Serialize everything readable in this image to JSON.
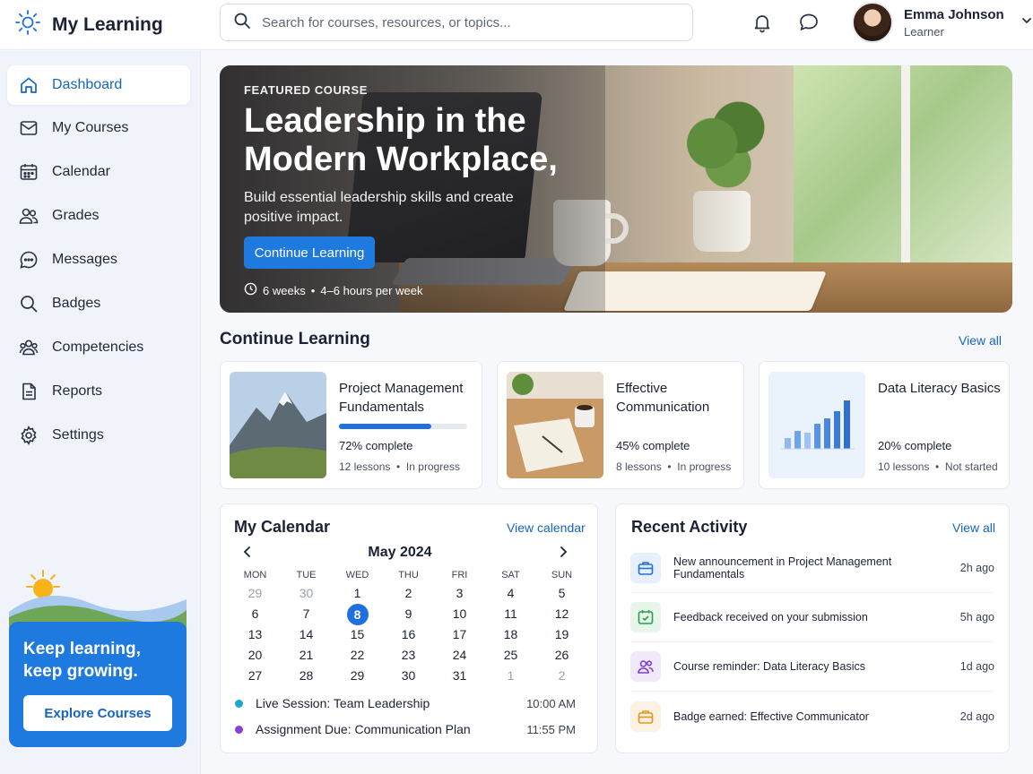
{
  "app": {
    "title": "My Learning",
    "brand_color": "#1f7ae0"
  },
  "search": {
    "placeholder": "Search for courses, resources, or topics..."
  },
  "user": {
    "name": "Emma Johnson",
    "role": "Learner"
  },
  "sidebar": {
    "items": [
      {
        "label": "Dashboard",
        "icon": "home-icon",
        "active": true
      },
      {
        "label": "My Courses",
        "icon": "book-icon"
      },
      {
        "label": "Calendar",
        "icon": "calendar-icon"
      },
      {
        "label": "Grades",
        "icon": "people-icon"
      },
      {
        "label": "Messages",
        "icon": "chat-icon"
      },
      {
        "label": "Badges",
        "icon": "search-icon"
      },
      {
        "label": "Competencies",
        "icon": "group-icon"
      },
      {
        "label": "Reports",
        "icon": "document-icon"
      },
      {
        "label": "Settings",
        "icon": "gear-icon"
      }
    ],
    "promo": {
      "text": "Keep learning, keep growing.",
      "button": "Explore Courses"
    }
  },
  "hero": {
    "eyebrow": "FEATURED COURSE",
    "title": "Leadership in the Modern Workplace,",
    "subtitle": "Build essential leadership skills and create positive impact.",
    "button": "Continue Learning",
    "duration": "6 weeks",
    "effort": "4–6 hours per week"
  },
  "continue_learning": {
    "title": "Continue Learning",
    "view_all": "View all",
    "courses": [
      {
        "title": "Project Management Fundamentals",
        "percent_label": "72% complete",
        "progress": 0.72,
        "lessons": "12 lessons",
        "status": "In progress"
      },
      {
        "title": "Effective Communication",
        "percent_label": "45% complete",
        "progress": 0.45,
        "lessons": "8 lessons",
        "status": "In progress"
      },
      {
        "title": "Data Literacy Basics",
        "percent_label": "20% complete",
        "progress": 0.2,
        "lessons": "10 lessons",
        "status": "Not started"
      }
    ]
  },
  "calendar": {
    "title": "My Calendar",
    "view_link": "View calendar",
    "month": "May 2024",
    "weekdays": [
      "MON",
      "TUE",
      "WED",
      "THU",
      "FRI",
      "SAT",
      "SUN"
    ],
    "weeks": [
      [
        "29",
        "30",
        "1",
        "2",
        "3",
        "4",
        "5"
      ],
      [
        "6",
        "7",
        "8",
        "9",
        "10",
        "11",
        "12"
      ],
      [
        "13",
        "14",
        "15",
        "16",
        "17",
        "18",
        "19"
      ],
      [
        "20",
        "21",
        "22",
        "23",
        "24",
        "25",
        "26"
      ],
      [
        "27",
        "28",
        "29",
        "30",
        "31",
        "1",
        "2"
      ]
    ],
    "today": "8",
    "events": [
      {
        "title": "Live Session: Team Leadership",
        "time": "10:00 AM",
        "color": "#1ea7c9"
      },
      {
        "title": "Assignment Due: Communication Plan",
        "time": "11:55 PM",
        "color": "#8a3fd1"
      }
    ]
  },
  "activity": {
    "title": "Recent Activity",
    "view_all": "View all",
    "items": [
      {
        "text": "New announcement in Project Management Fundamentals",
        "time": "2h ago",
        "icon": "briefcase-icon",
        "color": "#1f6fe0",
        "bg": "#e6f0fd"
      },
      {
        "text": "Feedback received on your submission",
        "time": "5h ago",
        "icon": "calendar-check-icon",
        "color": "#2e9d4e",
        "bg": "#e6f6ea"
      },
      {
        "text": "Course reminder: Data Literacy Basics",
        "time": "1d ago",
        "icon": "people-icon",
        "color": "#7a3fd1",
        "bg": "#f0e8fb"
      },
      {
        "text": "Badge earned: Effective Communicator",
        "time": "2d ago",
        "icon": "briefcase-icon",
        "color": "#e69420",
        "bg": "#fdf2e1"
      }
    ]
  }
}
